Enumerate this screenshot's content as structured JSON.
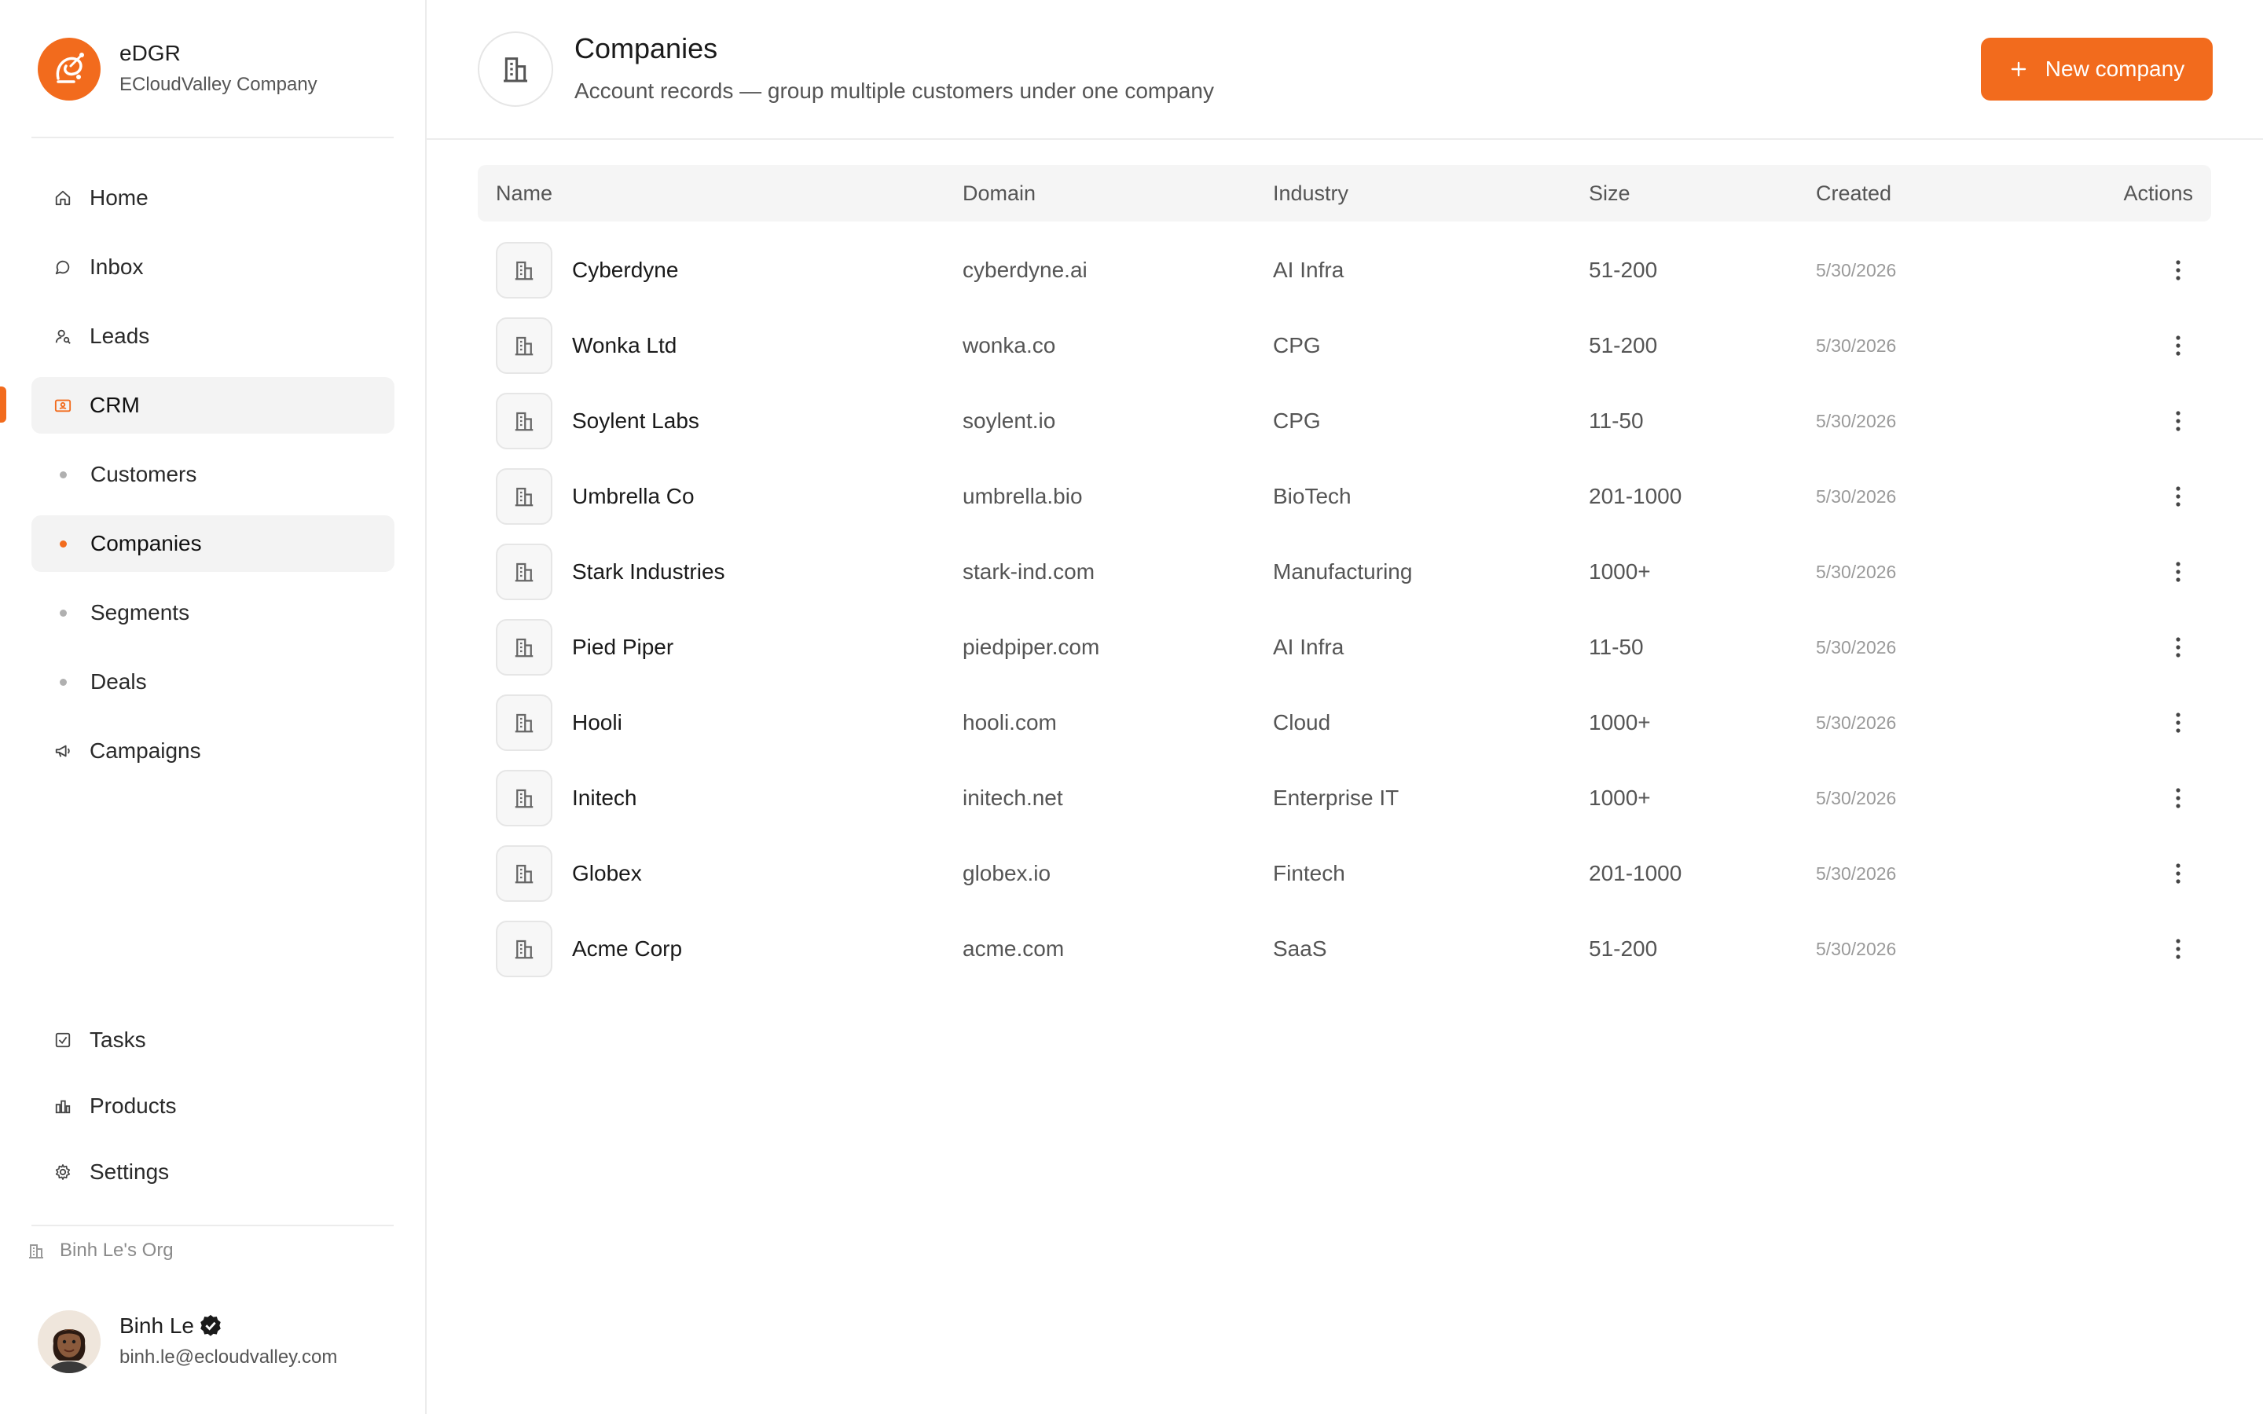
{
  "brand": {
    "name": "eDGR",
    "subtitle": "ECloudValley Company",
    "accent": "#f26b1d"
  },
  "sidebar": {
    "items": [
      {
        "label": "Home",
        "icon": "home-icon"
      },
      {
        "label": "Inbox",
        "icon": "chat-bubble-icon"
      },
      {
        "label": "Leads",
        "icon": "user-search-icon"
      },
      {
        "label": "CRM",
        "icon": "contact-card-icon"
      },
      {
        "label": "Customers",
        "icon": "dot"
      },
      {
        "label": "Companies",
        "icon": "dot"
      },
      {
        "label": "Segments",
        "icon": "dot"
      },
      {
        "label": "Deals",
        "icon": "dot"
      },
      {
        "label": "Campaigns",
        "icon": "megaphone-icon"
      }
    ],
    "bottom_items": [
      {
        "label": "Tasks",
        "icon": "checkbox-icon"
      },
      {
        "label": "Products",
        "icon": "chart-bars-icon"
      },
      {
        "label": "Settings",
        "icon": "gear-icon"
      }
    ],
    "org": "Binh Le's Org",
    "user": {
      "name": "Binh Le",
      "email": "binh.le@ecloudvalley.com"
    }
  },
  "header": {
    "title": "Companies",
    "subtitle": "Account records — group multiple customers under one company",
    "new_button": "New company"
  },
  "table": {
    "columns": [
      "Name",
      "Domain",
      "Industry",
      "Size",
      "Created",
      "Actions"
    ],
    "rows": [
      {
        "name": "Cyberdyne",
        "domain": "cyberdyne.ai",
        "industry": "AI Infra",
        "size": "51-200",
        "created": "5/30/2026"
      },
      {
        "name": "Wonka Ltd",
        "domain": "wonka.co",
        "industry": "CPG",
        "size": "51-200",
        "created": "5/30/2026"
      },
      {
        "name": "Soylent Labs",
        "domain": "soylent.io",
        "industry": "CPG",
        "size": "11-50",
        "created": "5/30/2026"
      },
      {
        "name": "Umbrella Co",
        "domain": "umbrella.bio",
        "industry": "BioTech",
        "size": "201-1000",
        "created": "5/30/2026"
      },
      {
        "name": "Stark Industries",
        "domain": "stark-ind.com",
        "industry": "Manufacturing",
        "size": "1000+",
        "created": "5/30/2026"
      },
      {
        "name": "Pied Piper",
        "domain": "piedpiper.com",
        "industry": "AI Infra",
        "size": "11-50",
        "created": "5/30/2026"
      },
      {
        "name": "Hooli",
        "domain": "hooli.com",
        "industry": "Cloud",
        "size": "1000+",
        "created": "5/30/2026"
      },
      {
        "name": "Initech",
        "domain": "initech.net",
        "industry": "Enterprise IT",
        "size": "1000+",
        "created": "5/30/2026"
      },
      {
        "name": "Globex",
        "domain": "globex.io",
        "industry": "Fintech",
        "size": "201-1000",
        "created": "5/30/2026"
      },
      {
        "name": "Acme Corp",
        "domain": "acme.com",
        "industry": "SaaS",
        "size": "51-200",
        "created": "5/30/2026"
      }
    ]
  }
}
